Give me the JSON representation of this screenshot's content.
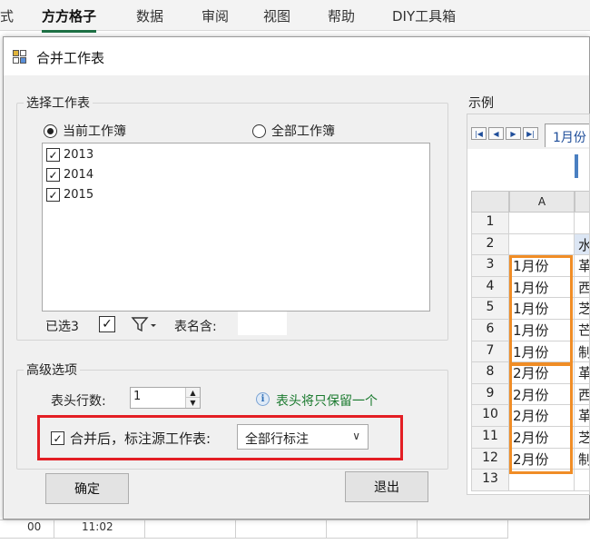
{
  "ribbon": {
    "tabs": [
      {
        "label": "式"
      },
      {
        "label": "方方格子"
      },
      {
        "label": "数据"
      },
      {
        "label": "审阅"
      },
      {
        "label": "视图"
      },
      {
        "label": "帮助"
      },
      {
        "label": "DIY工具箱"
      }
    ]
  },
  "background_grid": {
    "cell_left": "00",
    "cell_right": "11:02"
  },
  "dialog": {
    "title": "合并工作表",
    "select_group": {
      "legend": "选择工作表",
      "radio_current": "当前工作簿",
      "radio_all": "全部工作簿",
      "sheets": [
        {
          "name": "2013",
          "checked": true
        },
        {
          "name": "2014",
          "checked": true
        },
        {
          "name": "2015",
          "checked": true
        }
      ],
      "selected_label": "已选3",
      "sheet_name_label": "表名含:",
      "sheet_name_value": ""
    },
    "advanced_group": {
      "legend": "高级选项",
      "header_rows_label": "表头行数:",
      "header_rows_value": "1",
      "hint": "表头将只保留一个",
      "mark_source_label": "合并后，标注源工作表:",
      "mark_source_checked": true,
      "mark_mode_value": "全部行标注"
    },
    "ok_label": "确定",
    "exit_label": "退出",
    "example": {
      "legend": "示例",
      "sheet_tab": "1月份",
      "column_a": "A",
      "rows": [
        {
          "n": "1",
          "a": "",
          "b": ""
        },
        {
          "n": "2",
          "a": "",
          "b": "水"
        },
        {
          "n": "3",
          "a": "1月份",
          "b": "革"
        },
        {
          "n": "4",
          "a": "1月份",
          "b": "西"
        },
        {
          "n": "5",
          "a": "1月份",
          "b": "芝"
        },
        {
          "n": "6",
          "a": "1月份",
          "b": "芒"
        },
        {
          "n": "7",
          "a": "1月份",
          "b": "制"
        },
        {
          "n": "8",
          "a": "2月份",
          "b": "革"
        },
        {
          "n": "9",
          "a": "2月份",
          "b": "西"
        },
        {
          "n": "10",
          "a": "2月份",
          "b": "革"
        },
        {
          "n": "11",
          "a": "2月份",
          "b": "芝"
        },
        {
          "n": "12",
          "a": "2月份",
          "b": "制"
        },
        {
          "n": "13",
          "a": "",
          "b": ""
        }
      ]
    }
  },
  "colors": {
    "highlight_red": "#e31e24",
    "highlight_orange": "#f08d26",
    "hint_green": "#1a7a2e",
    "ribbon_accent": "#1e7145"
  }
}
